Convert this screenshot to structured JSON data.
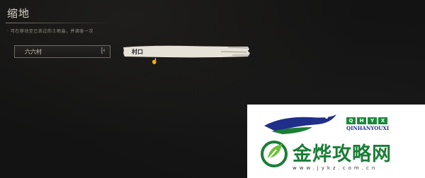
{
  "header": {
    "title": "缩地",
    "description": "· 可在移动至已去过的土地庙，并调息一次"
  },
  "location_select": {
    "value": "六六村",
    "arrow": "|‹"
  },
  "destination_item": {
    "label": "村口"
  },
  "colors": {
    "background": "#131313",
    "brush_stroke": "#e6e2d8",
    "watermark_green": "#1b7d36",
    "watermark_blue": "#1f2f8a"
  },
  "watermark": {
    "badge_letters": [
      "Q",
      "H",
      "Y",
      "X"
    ],
    "subtitle": "QINHANYOUXI",
    "name": "金烨攻略网",
    "url": "www.jykz.com.cn"
  }
}
